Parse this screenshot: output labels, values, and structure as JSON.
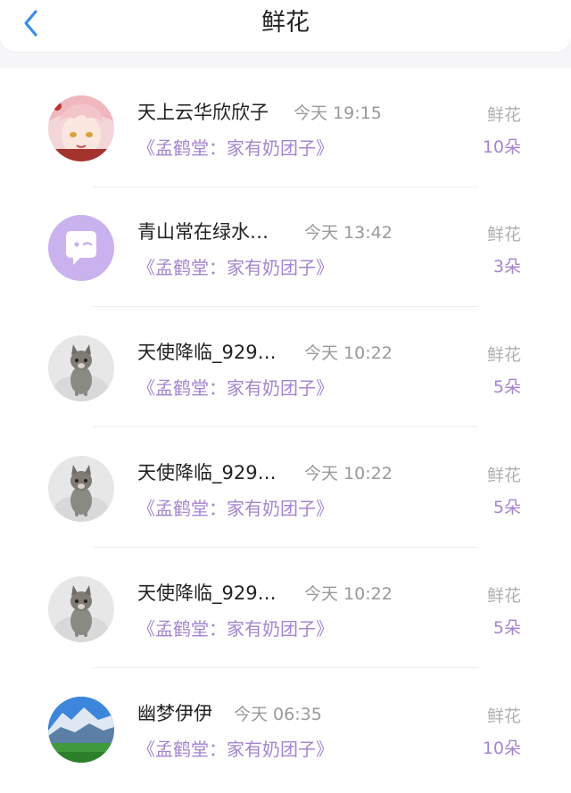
{
  "header": {
    "title": "鲜花",
    "back_icon": "chevron-left-icon"
  },
  "colors": {
    "accent_purple": "#a585cf",
    "back_blue": "#3a8ee6",
    "muted_gray": "#999999"
  },
  "items": [
    {
      "name": "天上云华欣欣子",
      "time": "今天 19:15",
      "book": "《孟鹤堂：家有奶团子》",
      "gift_label": "鲜花",
      "gift_count": "10朵",
      "avatar": "anime-avatar"
    },
    {
      "name": "青山常在绿水…",
      "time": "今天 13:42",
      "book": "《孟鹤堂：家有奶团子》",
      "gift_label": "鲜花",
      "gift_count": "3朵",
      "avatar": "default-avatar"
    },
    {
      "name": "天使降临_929…",
      "time": "今天 10:22",
      "book": "《孟鹤堂：家有奶团子》",
      "gift_label": "鲜花",
      "gift_count": "5朵",
      "avatar": "kitten-avatar"
    },
    {
      "name": "天使降临_929…",
      "time": "今天 10:22",
      "book": "《孟鹤堂：家有奶团子》",
      "gift_label": "鲜花",
      "gift_count": "5朵",
      "avatar": "kitten-avatar"
    },
    {
      "name": "天使降临_929…",
      "time": "今天 10:22",
      "book": "《孟鹤堂：家有奶团子》",
      "gift_label": "鲜花",
      "gift_count": "5朵",
      "avatar": "kitten-avatar"
    },
    {
      "name": "幽梦伊伊",
      "time": "今天 06:35",
      "book": "《孟鹤堂：家有奶团子》",
      "gift_label": "鲜花",
      "gift_count": "10朵",
      "avatar": "landscape-avatar"
    }
  ]
}
